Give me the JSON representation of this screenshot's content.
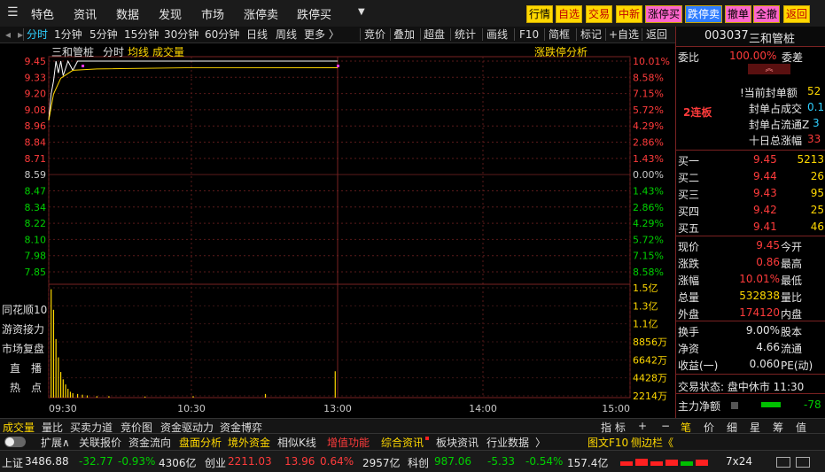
{
  "topmenu": {
    "items": [
      "特色",
      "资讯",
      "数据",
      "发现",
      "市场",
      "涨停卖",
      "跌停买"
    ],
    "quick": [
      {
        "label": "行情",
        "bg": "#ffd800",
        "fg": "#000000"
      },
      {
        "label": "自选",
        "bg": "#ffd800",
        "fg": "#c00000"
      },
      {
        "label": "交易",
        "bg": "#ffd800",
        "fg": "#c00000"
      },
      {
        "label": "中新",
        "bg": "#ffd800",
        "fg": "#c00000"
      },
      {
        "label": "涨停买",
        "bg": "#ff66cc",
        "fg": "#000000"
      },
      {
        "label": "跌停卖",
        "bg": "#2f7dff",
        "fg": "#ffffff"
      },
      {
        "label": "撤单",
        "bg": "#ff66cc",
        "fg": "#000000"
      },
      {
        "label": "全撤",
        "bg": "#ff66cc",
        "fg": "#000000"
      },
      {
        "label": "返回",
        "bg": "#ffd800",
        "fg": "#c00000"
      }
    ]
  },
  "periods": [
    "分时",
    "1分钟",
    "5分钟",
    "15分钟",
    "30分钟",
    "60分钟",
    "日线",
    "周线",
    "更多 〉"
  ],
  "tools": [
    "竞价",
    "叠加",
    "超盘",
    "统计",
    "画线",
    "F10",
    "简框",
    "标记",
    "+自选",
    "返回"
  ],
  "chart_header": {
    "name": "三和管桩",
    "mode": "分时",
    "line1": "均线",
    "line2": "成交量",
    "right": "涨跌停分析"
  },
  "side_buttons": [
    "同花顺10",
    "游资接力",
    "市场复盘",
    "直　播",
    "热　点"
  ],
  "chart_data": {
    "type": "line",
    "prev_close": 8.59,
    "y_ticks": [
      "9.45",
      "9.33",
      "9.20",
      "9.08",
      "8.96",
      "8.84",
      "8.71",
      "8.59",
      "8.47",
      "8.34",
      "8.22",
      "8.10",
      "7.98",
      "7.85"
    ],
    "pct_ticks": [
      "10.01%",
      "8.58%",
      "7.15%",
      "5.72%",
      "4.29%",
      "2.86%",
      "1.43%",
      "0.00%",
      "1.43%",
      "2.86%",
      "4.29%",
      "5.72%",
      "7.15%",
      "8.58%"
    ],
    "ylim": [
      7.73,
      9.45
    ],
    "x_ticks": [
      "09:30",
      "10:30",
      "13:00",
      "14:00",
      "15:00"
    ],
    "price_series": [
      [
        0,
        9.0
      ],
      [
        1,
        9.2
      ],
      [
        2,
        9.3
      ],
      [
        3,
        9.45
      ],
      [
        4,
        9.36
      ],
      [
        5,
        9.45
      ],
      [
        6,
        9.34
      ],
      [
        8,
        9.45
      ],
      [
        10,
        9.38
      ],
      [
        12,
        9.45
      ],
      [
        14,
        9.45
      ],
      [
        120,
        9.45
      ]
    ],
    "avg_series": [
      [
        0,
        9.0
      ],
      [
        2,
        9.2
      ],
      [
        5,
        9.32
      ],
      [
        10,
        9.38
      ],
      [
        20,
        9.39
      ],
      [
        60,
        9.4
      ],
      [
        120,
        9.4
      ]
    ],
    "vol_ticks": [
      "1.5亿",
      "1.3亿",
      "1.1亿",
      "8856万",
      "6642万",
      "4428万",
      "2214万"
    ],
    "volume_bars": [
      [
        1,
        1.48
      ],
      [
        2,
        1.2
      ],
      [
        3,
        0.8
      ],
      [
        4,
        0.55
      ],
      [
        5,
        0.35
      ],
      [
        6,
        0.25
      ],
      [
        7,
        0.18
      ],
      [
        8,
        0.12
      ],
      [
        9,
        0.08
      ],
      [
        10,
        0.06
      ],
      [
        12,
        0.05
      ],
      [
        14,
        0.04
      ],
      [
        16,
        0.03
      ],
      [
        20,
        0.02
      ],
      [
        25,
        0.02
      ],
      [
        40,
        0.015
      ],
      [
        60,
        0.02
      ],
      [
        90,
        0.05
      ],
      [
        119,
        0.36
      ]
    ]
  },
  "vol_label": "成交量",
  "right_panel": {
    "code": "003037",
    "name": "三和管桩",
    "webi_label": "委比",
    "webi_val": "100.00%",
    "weicha_label": "委差",
    "board": "2连板",
    "stats": [
      {
        "label": "!当前封单额",
        "val": "52"
      },
      {
        "label": "封单占成交",
        "val": "0.1"
      },
      {
        "label": "封单占流通Z",
        "val": "3"
      },
      {
        "label": "十日总涨幅",
        "val": "33"
      }
    ],
    "bids": [
      {
        "label": "买一",
        "price": "9.45",
        "vol": "5213"
      },
      {
        "label": "买二",
        "price": "9.44",
        "vol": "26"
      },
      {
        "label": "买三",
        "price": "9.43",
        "vol": "95"
      },
      {
        "label": "买四",
        "price": "9.42",
        "vol": "25"
      },
      {
        "label": "买五",
        "price": "9.41",
        "vol": "46"
      }
    ],
    "quote": [
      {
        "l1": "现价",
        "v1": "9.45",
        "l2": "今开"
      },
      {
        "l1": "涨跌",
        "v1": "0.86",
        "l2": "最高"
      },
      {
        "l1": "涨幅",
        "v1": "10.01%",
        "l2": "最低"
      },
      {
        "l1": "总量",
        "v1": "532838",
        "l2": "量比"
      },
      {
        "l1": "外盘",
        "v1": "174120",
        "l2": "内盘"
      }
    ],
    "quote2": [
      {
        "l1": "换手",
        "v1": "9.00%",
        "l2": "股本"
      },
      {
        "l1": "净资",
        "v1": "4.66",
        "l2": "流通"
      },
      {
        "l1": "收益(一)",
        "v1": "0.060",
        "l2": "PE(动)"
      }
    ],
    "trade_status": "交易状态: 盘中休市 11:30",
    "net_label": "主力净额",
    "net_val": "-78",
    "tail_tabs": [
      "笔",
      "价",
      "细",
      "星",
      "筹",
      "值"
    ]
  },
  "tabs1": [
    "成交量",
    "量比",
    "买卖力道",
    "竞价图",
    "资金驱动力",
    "资金博弈"
  ],
  "tabs1_right": [
    "指 标",
    "+",
    "−"
  ],
  "tabs2": [
    "扩展∧",
    "关联报价",
    "资金流向",
    "盘面分析",
    "境外资金",
    "相似K线",
    "增值功能",
    "综合资讯",
    "板块资讯",
    "行业数据",
    "〉"
  ],
  "tabs2_right": [
    "图文F10",
    "侧边栏《"
  ],
  "status": [
    {
      "label": "上证",
      "v1": "3486.88",
      "v2": "-32.77",
      "v3": "-0.93%",
      "v4": "4306亿"
    },
    {
      "label": "创业",
      "v1": "2211.03",
      "v2": "13.96",
      "v3": "0.64%",
      "v4": "2957亿"
    },
    {
      "label": "科创",
      "v1": "987.06",
      "v2": "-5.33",
      "v3": "-0.54%",
      "v4": "157.4亿"
    }
  ],
  "status_right": "7x24"
}
